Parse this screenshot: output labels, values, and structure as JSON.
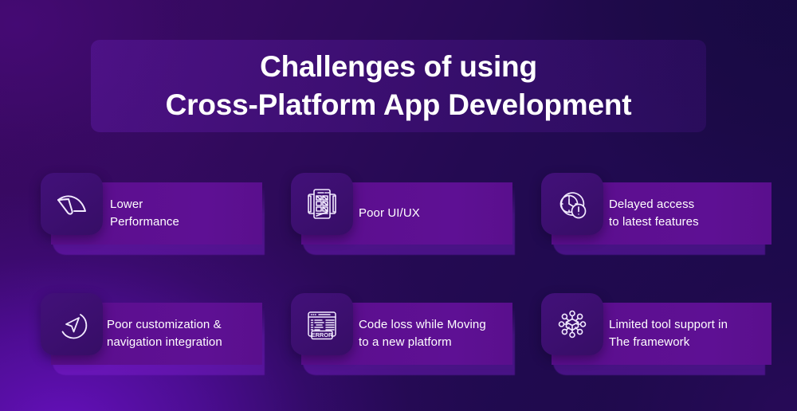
{
  "background": {
    "top_left_color": "#3a0860",
    "top_right_color": "#190a4a",
    "bottom_left_color": "#5210a0",
    "bottom_right_color": "#2a0b52"
  },
  "title": {
    "line1": "Challenges of using",
    "line2": "Cross-Platform App Development",
    "text_color": "#ffffff",
    "panel_color": "#561696"
  },
  "cards": [
    {
      "icon": "speedometer-icon",
      "line1": "Lower",
      "line2": "Performance"
    },
    {
      "icon": "wireframe-layout-icon",
      "line1": "Poor UI/UX",
      "line2": ""
    },
    {
      "icon": "clock-alert-icon",
      "line1": "Delayed access",
      "line2": "to latest features"
    },
    {
      "icon": "navigation-arrow-icon",
      "line1": "Poor customization &",
      "line2": "navigation integration"
    },
    {
      "icon": "code-error-window-icon",
      "line1": "Code loss while Moving",
      "line2": "to a new platform",
      "icon_label": "ERROR"
    },
    {
      "icon": "network-nodes-cube-icon",
      "line1": "Limited tool support in",
      "line2": "The framework"
    }
  ],
  "theme": {
    "bar_color": "#5d0f91",
    "tile_color": "#3c0f6f",
    "icon_stroke": "#f2eaff"
  }
}
